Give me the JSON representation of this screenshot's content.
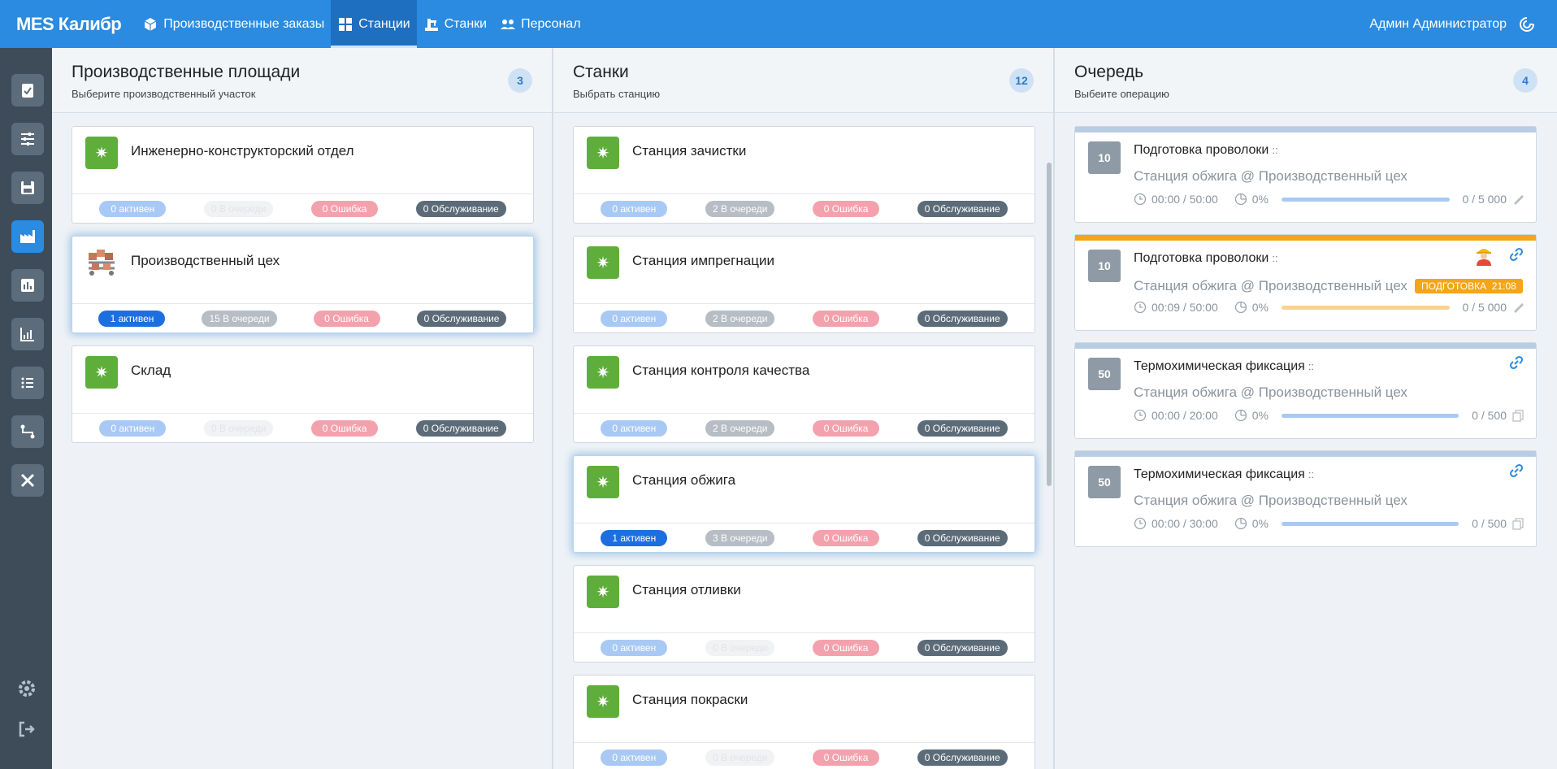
{
  "app": {
    "brand": "MES Калибр"
  },
  "nav": [
    {
      "label": "Производственные заказы",
      "icon": "cube-icon"
    },
    {
      "label": "Станции",
      "icon": "grid-icon",
      "active": true
    },
    {
      "label": "Станки",
      "icon": "machine-icon"
    },
    {
      "label": "Персонал",
      "icon": "people-icon"
    }
  ],
  "user": {
    "name": "Админ Администратор"
  },
  "areas": {
    "title": "Производственные площади",
    "subtitle": "Выберите производственный участок",
    "count": "3",
    "items": [
      {
        "name": "Инженерно-конструкторский отдел",
        "active": "0 активен",
        "queue": "0 В очереди",
        "error": "0 Ошибка",
        "service": "0 Обслуживание"
      },
      {
        "name": "Производственный цех",
        "active": "1 активен",
        "queue": "15 В очереди",
        "error": "0 Ошибка",
        "service": "0 Обслуживание"
      },
      {
        "name": "Склад",
        "active": "0 активен",
        "queue": "0 В очереди",
        "error": "0 Ошибка",
        "service": "0 Обслуживание"
      }
    ]
  },
  "stations": {
    "title": "Станки",
    "subtitle": "Выбрать станцию",
    "count": "12",
    "items": [
      {
        "name": "Станция зачистки",
        "active": "0 активен",
        "queue": "2 В очереди",
        "error": "0 Ошибка",
        "service": "0 Обслуживание"
      },
      {
        "name": "Станция импрегнации",
        "active": "0 активен",
        "queue": "2 В очереди",
        "error": "0 Ошибка",
        "service": "0 Обслуживание"
      },
      {
        "name": "Станция контроля качества",
        "active": "0 активен",
        "queue": "2 В очереди",
        "error": "0 Ошибка",
        "service": "0 Обслуживание"
      },
      {
        "name": "Станция обжига",
        "active": "1 активен",
        "queue": "3 В очереди",
        "error": "0 Ошибка",
        "service": "0 Обслуживание"
      },
      {
        "name": "Станция отливки",
        "active": "0 активен",
        "queue": "0 В очереди",
        "error": "0 Ошибка",
        "service": "0 Обслуживание"
      },
      {
        "name": "Станция покраски",
        "active": "0 активен",
        "queue": "0 В очереди",
        "error": "0 Ошибка",
        "service": "0 Обслуживание"
      }
    ]
  },
  "queue": {
    "title": "Очередь",
    "subtitle": "Выбеите операцию",
    "count": "4",
    "items": [
      {
        "num": "10",
        "name": "Подготовка проволоки",
        "drag": "::",
        "location": "Станция обжига @ Производственный цех",
        "time": "00:00 / 50:00",
        "percent": "0%",
        "qty": "0 / 5 000",
        "progress": 0
      },
      {
        "num": "10",
        "name": "Подготовка проволоки",
        "drag": "::",
        "location": "Станция обжига @ Производственный цех",
        "status": "ПОДГОТОВКА",
        "status_time": "21:08",
        "time": "00:09 / 50:00",
        "percent": "0%",
        "qty": "0 / 5 000",
        "progress": 0
      },
      {
        "num": "50",
        "name": "Термохимическая фиксация",
        "drag": "::",
        "location": "Станция обжига @ Производственный цех",
        "time": "00:00 / 20:00",
        "percent": "0%",
        "qty": "0 / 500",
        "progress": 0
      },
      {
        "num": "50",
        "name": "Термохимическая фиксация",
        "drag": "::",
        "location": "Станция обжига @ Производственный цех",
        "time": "00:00 / 30:00",
        "percent": "0%",
        "qty": "0 / 500",
        "progress": 0
      }
    ]
  },
  "colors": {
    "topbar": "#2a8be0",
    "rail": "#3e4c5a",
    "accent": "#2a8be0",
    "green": "#5fae3c",
    "orange": "#f5a516"
  }
}
